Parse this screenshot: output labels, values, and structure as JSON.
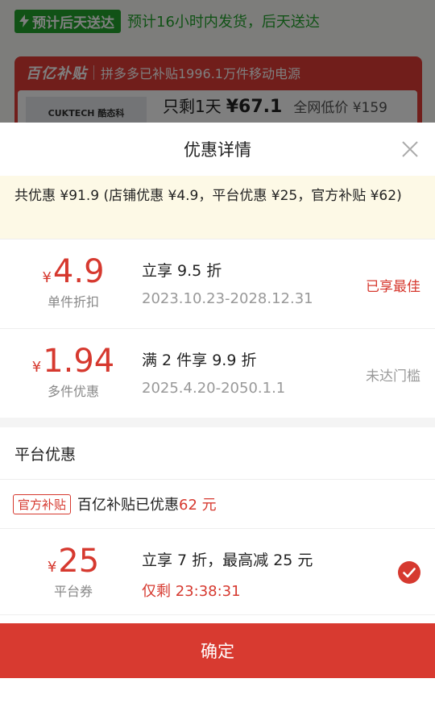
{
  "background": {
    "shipping_tag": "预计后天送达",
    "shipping_text": "预计16小时内发货，后天送达",
    "card_logo": "百亿补贴",
    "card_subsidy_text": "拼多多已补贴1996.1万件移动电源",
    "product_brand": "CUKTECH 酷态科",
    "price_only": "只剩1天",
    "price_amount": "¥67.1",
    "price_lowest": "全网低价 ¥159"
  },
  "sheet": {
    "title": "优惠详情",
    "summary": "共优惠 ¥91.9 (店铺优惠 ¥4.9，平台优惠 ¥25，官方补贴 ¥62)",
    "store_coupons": [
      {
        "yen": "¥",
        "amount": "4.9",
        "kind": "单件折扣",
        "title": "立享 9.5 折",
        "validity": "2023.10.23-2028.12.31",
        "status": "已享最佳"
      },
      {
        "yen": "¥",
        "amount": "1.94",
        "kind": "多件优惠",
        "title": "满 2 件享 9.9 折",
        "validity": "2025.4.20-2050.1.1",
        "status": "未达门槛"
      }
    ],
    "platform_section_title": "平台优惠",
    "official": {
      "tag": "官方补贴",
      "text": "百亿补贴已优惠",
      "amount": "62 元"
    },
    "platform_coupon": {
      "yen": "¥",
      "amount": "25",
      "kind": "平台券",
      "title": "立享 7 折，最高减 25 元",
      "countdown": "仅剩 23:38:31"
    },
    "confirm_label": "确定"
  },
  "colors": {
    "accent": "#d6392f",
    "green": "#22a52c",
    "summary_bg": "#fdf9e6"
  }
}
